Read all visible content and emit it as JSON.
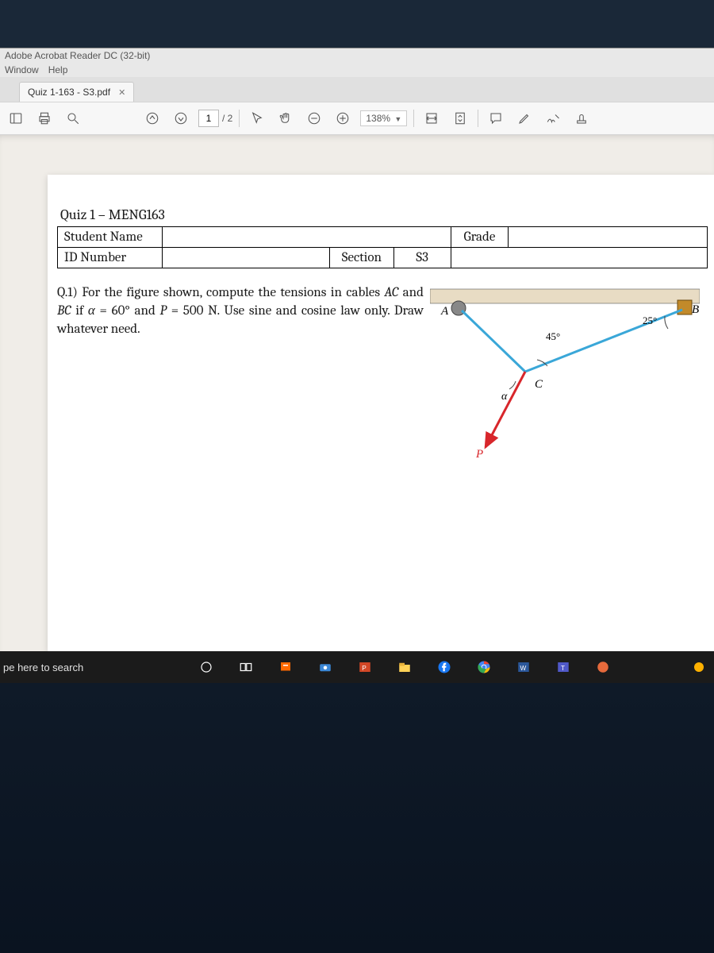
{
  "app": {
    "title": "Adobe Acrobat Reader DC (32-bit)"
  },
  "menubar": {
    "window": "Window",
    "help": "Help"
  },
  "tab": {
    "label": "Quiz 1-163 - S3.pdf"
  },
  "toolbar": {
    "page_current": "1",
    "page_total": "/ 2",
    "zoom": "138%"
  },
  "document": {
    "quiz_title": "Quiz 1 – MENG163",
    "row1_label": "Student Name",
    "row1_value": "",
    "grade_label": "Grade",
    "grade_value": "",
    "row2_label": "ID Number",
    "row2_value": "",
    "section_label": "Section",
    "section_value": "S3",
    "question_prefix": "Q.1)  For  the  figure  shown,  compute  the tensions in cables ",
    "cable_ac": "AC",
    "q_mid1": " and ",
    "cable_bc": "BC",
    "q_mid2": " if ",
    "alpha": "α",
    "q_mid3": " = 60° and ",
    "p_sym": "P",
    "q_mid4": " = 500 N. Use sine and cosine law only. Draw whatever need.",
    "fig": {
      "A": "A",
      "B": "B",
      "C": "C",
      "P": "P",
      "alpha": "α",
      "ang45": "45°",
      "ang25": "25°"
    }
  },
  "taskbar": {
    "search": "pe here to search"
  }
}
